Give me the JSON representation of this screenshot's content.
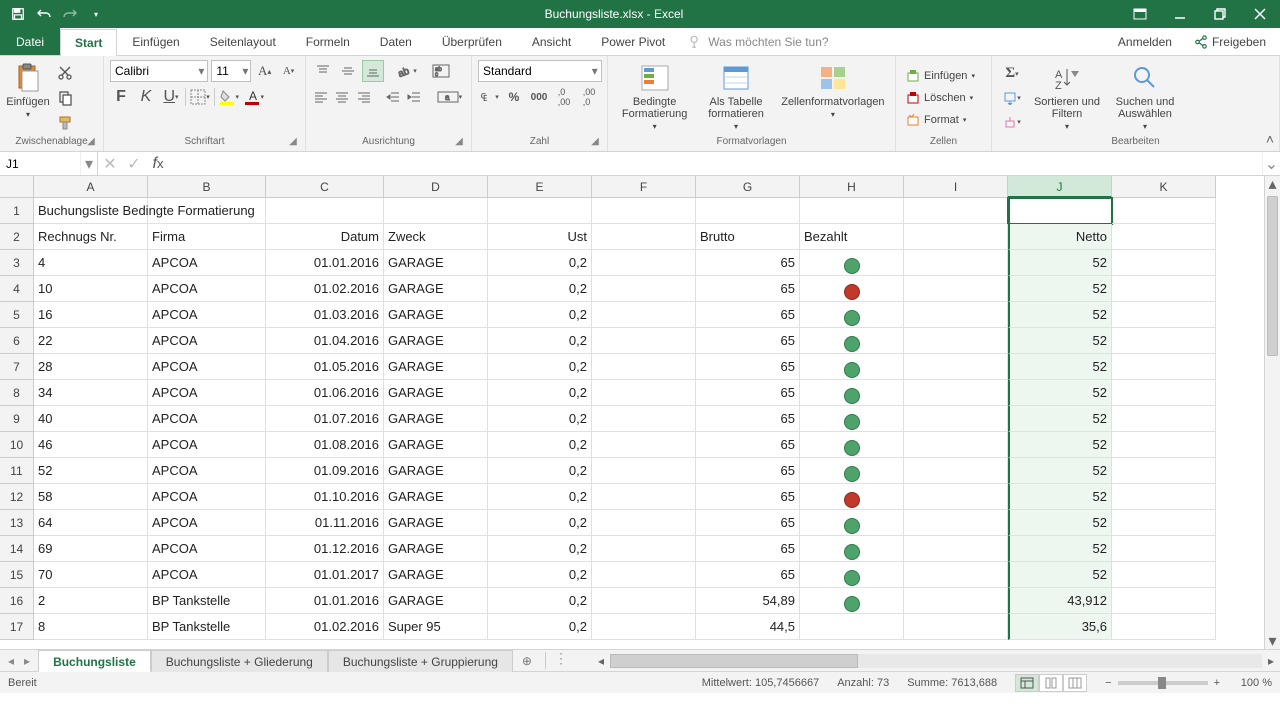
{
  "title": "Buchungsliste.xlsx - Excel",
  "tabs": {
    "file": "Datei",
    "items": [
      "Start",
      "Einfügen",
      "Seitenlayout",
      "Formeln",
      "Daten",
      "Überprüfen",
      "Ansicht",
      "Power Pivot"
    ],
    "active": "Start",
    "tellme": "Was möchten Sie tun?",
    "signin": "Anmelden",
    "share": "Freigeben"
  },
  "ribbon": {
    "clipboard": {
      "label": "Zwischenablage",
      "paste": "Einfügen"
    },
    "font": {
      "label": "Schriftart",
      "name": "Calibri",
      "size": "11"
    },
    "alignment": {
      "label": "Ausrichtung"
    },
    "number": {
      "label": "Zahl",
      "format": "Standard"
    },
    "styles": {
      "label": "Formatvorlagen",
      "cond": "Bedingte Formatierung",
      "table": "Als Tabelle formatieren",
      "cell": "Zellenformatvorlagen"
    },
    "cells": {
      "label": "Zellen",
      "insert": "Einfügen",
      "delete": "Löschen",
      "format": "Format"
    },
    "editing": {
      "label": "Bearbeiten",
      "sort": "Sortieren und Filtern",
      "find": "Suchen und Auswählen"
    }
  },
  "namebox": "J1",
  "formula": "",
  "columns": [
    {
      "l": "A",
      "w": 114
    },
    {
      "l": "B",
      "w": 118
    },
    {
      "l": "C",
      "w": 118
    },
    {
      "l": "D",
      "w": 104
    },
    {
      "l": "E",
      "w": 104
    },
    {
      "l": "F",
      "w": 104
    },
    {
      "l": "G",
      "w": 104
    },
    {
      "l": "H",
      "w": 104
    },
    {
      "l": "I",
      "w": 104
    },
    {
      "l": "J",
      "w": 104
    },
    {
      "l": "K",
      "w": 104
    }
  ],
  "selected_col": "J",
  "headers_row": {
    "A": "Rechnugs Nr.",
    "B": "Firma",
    "C": "Datum",
    "D": "Zweck",
    "E": "Ust",
    "G": "Brutto",
    "H": "Bezahlt",
    "J": "Netto"
  },
  "title_row": "Buchungsliste Bedingte Formatierung",
  "rows": [
    {
      "A": "4",
      "B": "APCOA",
      "C": "01.01.2016",
      "D": "GARAGE",
      "E": "0,2",
      "G": "65",
      "H": "green",
      "J": "52"
    },
    {
      "A": "10",
      "B": "APCOA",
      "C": "01.02.2016",
      "D": "GARAGE",
      "E": "0,2",
      "G": "65",
      "H": "red",
      "J": "52"
    },
    {
      "A": "16",
      "B": "APCOA",
      "C": "01.03.2016",
      "D": "GARAGE",
      "E": "0,2",
      "G": "65",
      "H": "green",
      "J": "52"
    },
    {
      "A": "22",
      "B": "APCOA",
      "C": "01.04.2016",
      "D": "GARAGE",
      "E": "0,2",
      "G": "65",
      "H": "green",
      "J": "52"
    },
    {
      "A": "28",
      "B": "APCOA",
      "C": "01.05.2016",
      "D": "GARAGE",
      "E": "0,2",
      "G": "65",
      "H": "green",
      "J": "52"
    },
    {
      "A": "34",
      "B": "APCOA",
      "C": "01.06.2016",
      "D": "GARAGE",
      "E": "0,2",
      "G": "65",
      "H": "green",
      "J": "52"
    },
    {
      "A": "40",
      "B": "APCOA",
      "C": "01.07.2016",
      "D": "GARAGE",
      "E": "0,2",
      "G": "65",
      "H": "green",
      "J": "52"
    },
    {
      "A": "46",
      "B": "APCOA",
      "C": "01.08.2016",
      "D": "GARAGE",
      "E": "0,2",
      "G": "65",
      "H": "green",
      "J": "52"
    },
    {
      "A": "52",
      "B": "APCOA",
      "C": "01.09.2016",
      "D": "GARAGE",
      "E": "0,2",
      "G": "65",
      "H": "green",
      "J": "52"
    },
    {
      "A": "58",
      "B": "APCOA",
      "C": "01.10.2016",
      "D": "GARAGE",
      "E": "0,2",
      "G": "65",
      "H": "red",
      "J": "52"
    },
    {
      "A": "64",
      "B": "APCOA",
      "C": "01.11.2016",
      "D": "GARAGE",
      "E": "0,2",
      "G": "65",
      "H": "green",
      "J": "52"
    },
    {
      "A": "69",
      "B": "APCOA",
      "C": "01.12.2016",
      "D": "GARAGE",
      "E": "0,2",
      "G": "65",
      "H": "green",
      "J": "52"
    },
    {
      "A": "70",
      "B": "APCOA",
      "C": "01.01.2017",
      "D": "GARAGE",
      "E": "0,2",
      "G": "65",
      "H": "green",
      "J": "52"
    },
    {
      "A": "2",
      "B": "BP Tankstelle",
      "C": "01.01.2016",
      "D": "GARAGE",
      "E": "0,2",
      "G": "54,89",
      "H": "green",
      "J": "43,912"
    },
    {
      "A": "8",
      "B": "BP Tankstelle",
      "C": "01.02.2016",
      "D": "Super 95",
      "E": "0,2",
      "G": "44,5",
      "H": "",
      "J": "35,6"
    }
  ],
  "sheet_tabs": {
    "items": [
      "Buchungsliste",
      "Buchungsliste + Gliederung",
      "Buchungsliste + Gruppierung"
    ],
    "active": "Buchungsliste"
  },
  "status": {
    "ready": "Bereit",
    "avg_l": "Mittelwert:",
    "avg": "105,7456667",
    "cnt_l": "Anzahl:",
    "cnt": "73",
    "sum_l": "Summe:",
    "sum": "7613,688",
    "zoom": "100 %"
  }
}
